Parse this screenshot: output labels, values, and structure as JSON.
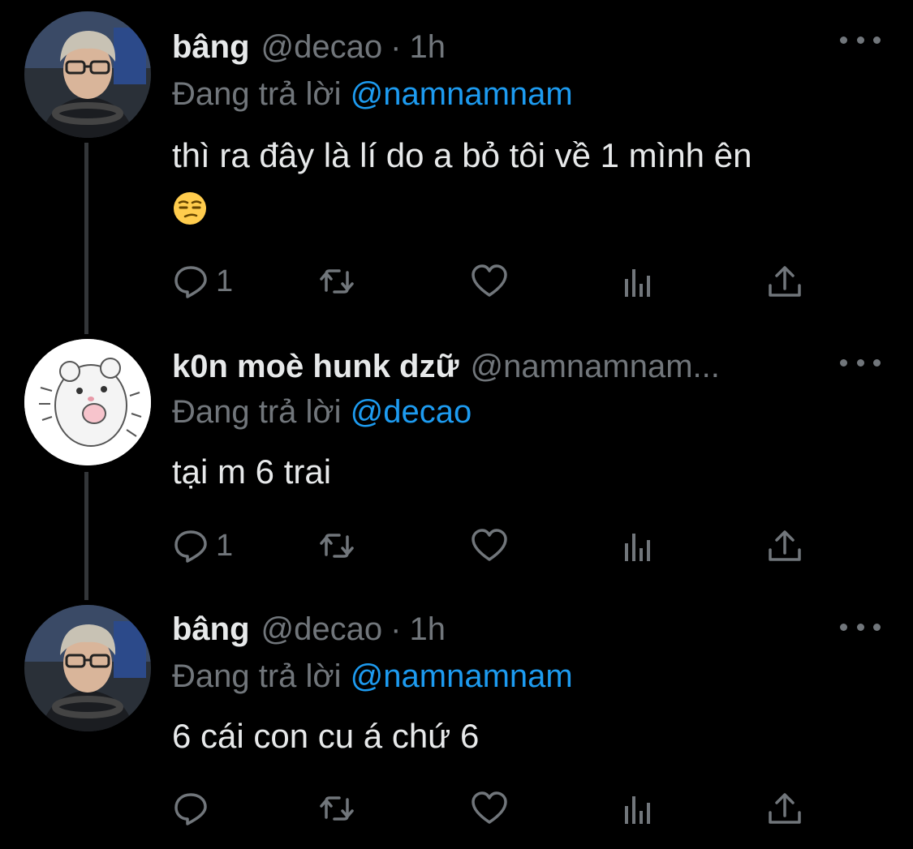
{
  "tweets": [
    {
      "name": "bâng",
      "handle": "@decao",
      "separator": "·",
      "time": "1h",
      "reply_prefix": "Đang trả lời ",
      "reply_mention": "@namnamnam",
      "text": "thì ra đây là lí do a bỏ tôi về 1 mình ên",
      "emoji": "unamused-face-emoji",
      "reply_count": "1"
    },
    {
      "name": "k0n moè hunk dzữ",
      "handle": "@namnamnam...",
      "reply_prefix": "Đang trả lời ",
      "reply_mention": "@decao",
      "text": "tại m 6 trai",
      "reply_count": "1"
    },
    {
      "name": "bâng",
      "handle": "@decao",
      "separator": "·",
      "time": "1h",
      "reply_prefix": "Đang trả lời ",
      "reply_mention": "@namnamnam",
      "text": "6 cái con cu á chứ 6",
      "reply_count": ""
    }
  ],
  "icons": {
    "reply": "reply-icon",
    "retweet": "retweet-icon",
    "like": "heart-icon",
    "views": "analytics-icon",
    "share": "share-icon",
    "more": "more-icon"
  },
  "colors": {
    "background": "#000000",
    "text": "#e7e9ea",
    "secondary": "#71767b",
    "accent": "#1d9bf0",
    "thread_line": "#333639"
  }
}
